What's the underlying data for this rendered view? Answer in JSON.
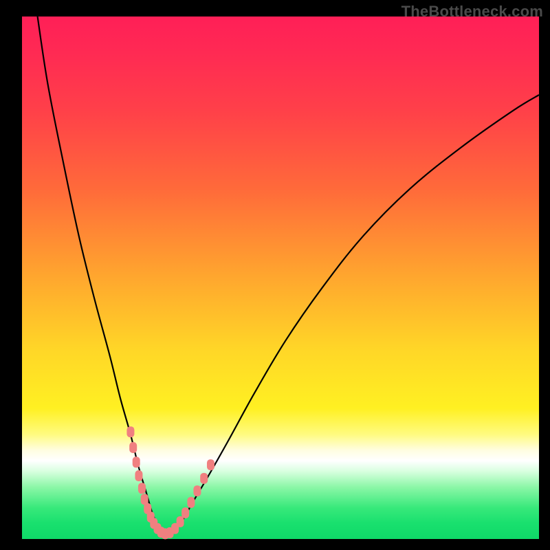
{
  "watermark": "TheBottleneck.com",
  "colors": {
    "frame": "#000000",
    "curve": "#000000",
    "marker": "#f08080",
    "gradient_stops": [
      "#ff1f57",
      "#ff2a53",
      "#ff4049",
      "#ff6a3a",
      "#ffa72e",
      "#ffd727",
      "#fff022",
      "#fffb80",
      "#fffde0",
      "#ffffff",
      "#d9ffe0",
      "#8df7a8",
      "#38e97b",
      "#19e06e",
      "#0fd968"
    ]
  },
  "chart_data": {
    "type": "line",
    "title": "",
    "xlabel": "",
    "ylabel": "",
    "xlim": [
      0,
      100
    ],
    "ylim": [
      0,
      100
    ],
    "series": [
      {
        "name": "bottleneck-curve",
        "x": [
          3,
          5,
          8,
          11,
          14,
          17,
          19,
          21,
          22.5,
          24,
          25.2,
          26.4,
          27.8,
          29.2,
          31,
          33,
          36,
          40,
          45,
          51,
          58,
          66,
          75,
          85,
          95,
          100
        ],
        "y": [
          100,
          87,
          72,
          58,
          46,
          35,
          27,
          20,
          14,
          9,
          5,
          2.5,
          1,
          1.5,
          3.5,
          7,
          12,
          19,
          28,
          38,
          48,
          58,
          67,
          75,
          82,
          85
        ]
      }
    ],
    "markers": {
      "name": "highlight-points",
      "x": [
        21.0,
        21.5,
        22.1,
        22.6,
        23.2,
        23.7,
        24.3,
        24.9,
        25.5,
        26.2,
        26.9,
        27.7,
        28.6,
        29.6,
        30.6,
        31.6,
        32.7,
        33.9,
        35.2,
        36.5
      ],
      "y": [
        20.5,
        17.5,
        14.7,
        12.1,
        9.7,
        7.6,
        5.8,
        4.2,
        3.0,
        2.0,
        1.3,
        1.0,
        1.2,
        2.0,
        3.3,
        5.0,
        7.0,
        9.2,
        11.6,
        14.2
      ]
    }
  }
}
